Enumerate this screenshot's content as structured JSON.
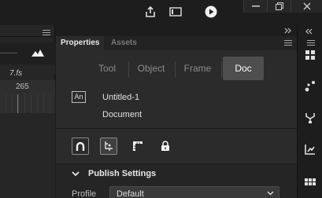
{
  "timeline": {
    "fps_label": "7.fs",
    "frame_number": "265"
  },
  "properties": {
    "tabs": [
      {
        "label": "Properties",
        "active": true
      },
      {
        "label": "Assets",
        "active": false
      }
    ],
    "segments": [
      {
        "label": "Tool",
        "active": false
      },
      {
        "label": "Object",
        "active": false
      },
      {
        "label": "Frame",
        "active": false
      },
      {
        "label": "Doc",
        "active": true
      }
    ],
    "doc": {
      "badge": "An",
      "name": "Untitled-1",
      "type": "Document"
    },
    "tool_icons": [
      "magnet-icon",
      "snap-to-pixels-icon",
      "snap-ruler-icon",
      "lock-icon"
    ],
    "publish": {
      "heading": "Publish Settings",
      "profile_label": "Profile",
      "profile_value": "Default"
    }
  },
  "icons": {
    "share": "share-icon",
    "screen": "screen-icon",
    "play": "play-icon",
    "minimize": "minimize-icon",
    "restore": "restore-icon",
    "close": "close-icon",
    "collapse": "collapse-arrows-icon",
    "panel_menu": "panel-menu-icon",
    "dock": [
      "swatches-icon",
      "motion-presets-icon",
      "components-icon",
      "graph-icon",
      "color-grid-icon"
    ]
  },
  "colors": {
    "active_tab": "#4e4e4e",
    "panel": "#2b2b2b",
    "accent_white": "#ffffff"
  }
}
